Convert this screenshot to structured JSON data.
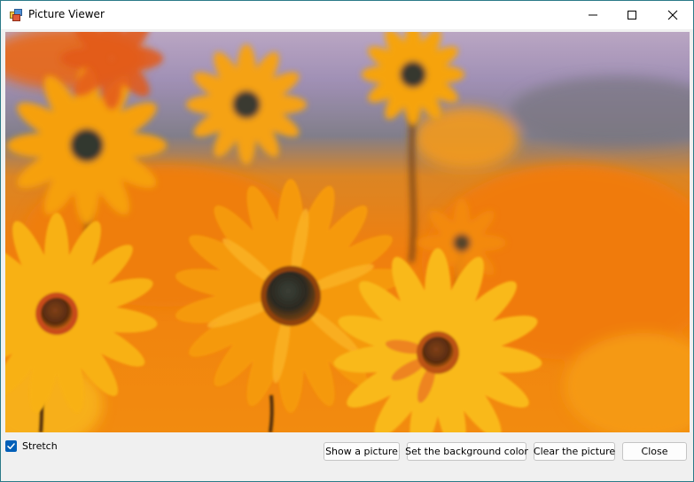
{
  "window": {
    "title": "Picture Viewer",
    "app_icon": "picture-viewer-app-icon",
    "caption_buttons": [
      "minimize-icon",
      "maximize-icon",
      "close-icon"
    ]
  },
  "picture": {
    "subject": "orange-and-yellow-daisies-photo"
  },
  "options": {
    "stretch_label": "Stretch",
    "stretch_checked": true
  },
  "buttons": {
    "show_picture": "Show a picture",
    "set_background": "Set the background color",
    "clear_picture": "Clear the picture",
    "close": "Close"
  },
  "colors": {
    "accent": "#005fb8",
    "window_border": "#2b7a88",
    "client_background": "#f0f0f0"
  }
}
